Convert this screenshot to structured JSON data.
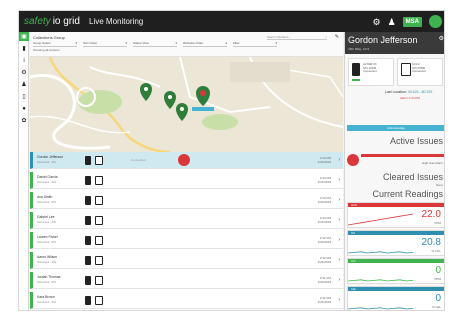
{
  "app": {
    "brand_first": "safety",
    "brand_second": "io grid",
    "title": "Live Monitoring",
    "org_badge": "MSA"
  },
  "filters": {
    "title": "Collections Group",
    "selects": [
      "Group Select",
      "Sort Order",
      "Status View",
      "Worksite Order",
      "Filter"
    ],
    "sub": "Showing all workers",
    "search_placeholder": "Search Workers..."
  },
  "workers": [
    {
      "name": "Gordon Jefferson",
      "sub": "Instrument - S/N",
      "status": "Connected",
      "time": "2:34 PM",
      "date": "1/24/2019",
      "selected": true,
      "alert": true
    },
    {
      "name": "Daniel Garcia",
      "sub": "Instrument - S/N",
      "status": "",
      "time": "2:33 PM",
      "date": "1/24/2019",
      "selected": false,
      "alert": false
    },
    {
      "name": "Ava Smith",
      "sub": "Instrument - S/N",
      "status": "",
      "time": "2:33 PM",
      "date": "1/24/2019",
      "selected": false,
      "alert": false
    },
    {
      "name": "Gabriel Lee",
      "sub": "Instrument - S/N",
      "status": "",
      "time": "2:33 PM",
      "date": "1/24/2019",
      "selected": false,
      "alert": false
    },
    {
      "name": "Lauren Fisher",
      "sub": "Instrument - S/N",
      "status": "",
      "time": "2:32 PM",
      "date": "1/24/2019",
      "selected": false,
      "alert": false
    },
    {
      "name": "Aaron Wilson",
      "sub": "Instrument - S/N",
      "status": "",
      "time": "2:32 PM",
      "date": "1/24/2019",
      "selected": false,
      "alert": false
    },
    {
      "name": "Jordan Thomas",
      "sub": "Instrument - S/N",
      "status": "",
      "time": "2:31 PM",
      "date": "1/24/2019",
      "selected": false,
      "alert": false
    },
    {
      "name": "Kara Brown",
      "sub": "Instrument - S/N",
      "status": "",
      "time": "2:31 PM",
      "date": "1/24/2019",
      "selected": false,
      "alert": false
    }
  ],
  "detail": {
    "name": "Gordon Jefferson",
    "sub": "ABC Bldg. 1274",
    "device1": {
      "line1": "ALTAIR 4X",
      "line2": "S/N 12345",
      "line3": "Connected"
    },
    "device2": {
      "line1": "Grid 2",
      "line2": "S/N 67890",
      "line3": "Connected"
    },
    "last_location_label": "Last Location",
    "last_location_value": "40.423, -80.225",
    "alarm_line": "Alarm 2:34 PM",
    "action_label": "Acknowledge",
    "active_issues_title": "Active Issues",
    "active_issues_sub": "High Gas Alarm",
    "cleared_issues_title": "Cleared Issues",
    "cleared_issues_sub": "None",
    "current_readings_title": "Current Readings"
  },
  "readings": [
    {
      "label": "H2S",
      "value": "22.0",
      "unit": "PPM",
      "color": "#d9373a"
    },
    {
      "label": "O2",
      "value": "20.8",
      "unit": "% VOL",
      "color": "#2f8fb0"
    },
    {
      "label": "CO",
      "value": "0",
      "unit": "PPM",
      "color": "#3fb34f"
    },
    {
      "label": "LEL",
      "value": "0",
      "unit": "% LEL",
      "color": "#2f8fb0"
    }
  ],
  "colors": {
    "accent": "#3fb34f",
    "alert": "#d9373a",
    "info": "#45b3d1"
  }
}
